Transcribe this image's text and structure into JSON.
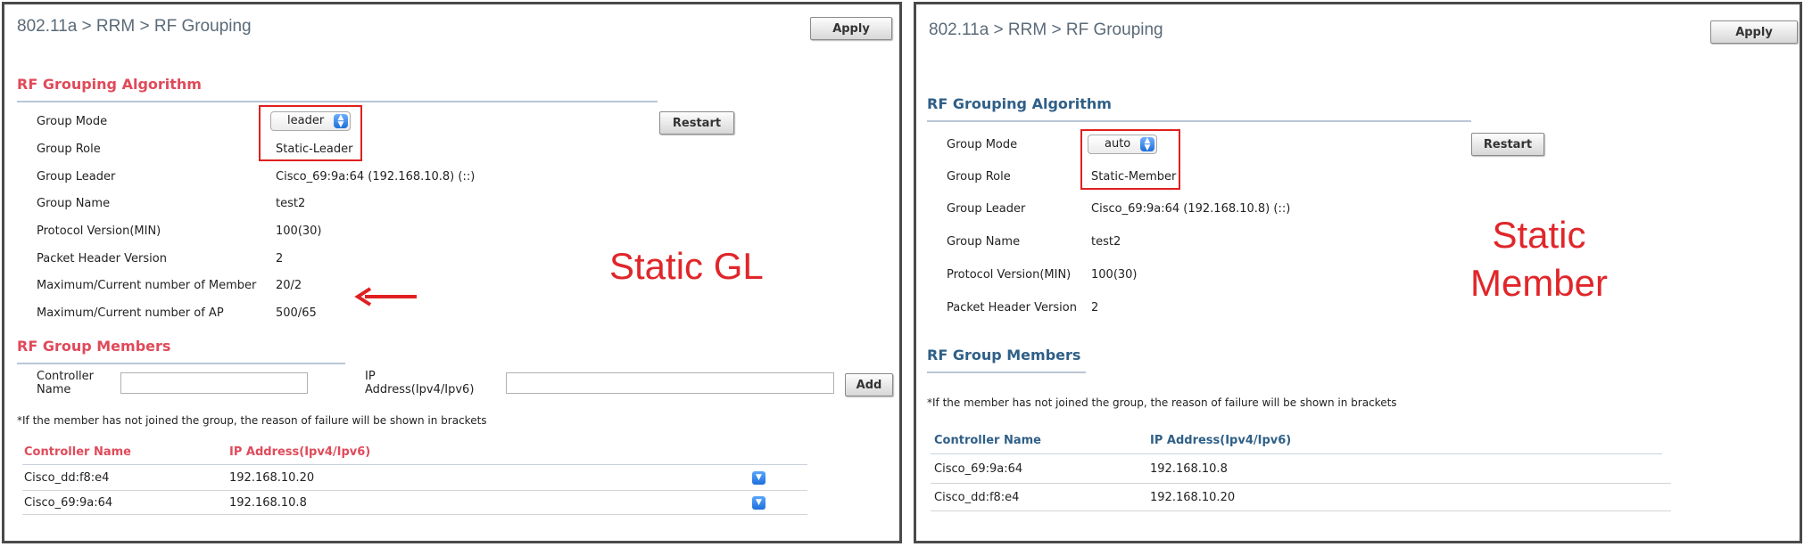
{
  "left": {
    "breadcrumb": "802.11a > RRM > RF Grouping",
    "apply": "Apply",
    "algo_title": "RF Grouping Algorithm",
    "restart": "Restart",
    "rows": [
      {
        "label": "Group Mode",
        "value": "leader"
      },
      {
        "label": "Group Role",
        "value": "Static-Leader"
      },
      {
        "label": "Group Leader",
        "value": "Cisco_69:9a:64 (192.168.10.8) (::)"
      },
      {
        "label": "Group Name",
        "value": "test2"
      },
      {
        "label": "Protocol Version(MIN)",
        "value": "100(30)"
      },
      {
        "label": "Packet Header Version",
        "value": "2"
      },
      {
        "label": "Maximum/Current number of Member",
        "value": "20/2"
      },
      {
        "label": "Maximum/Current number of AP",
        "value": "500/65"
      }
    ],
    "annotation": "Static GL",
    "members_title": "RF Group Members",
    "controller_name_label_1": "Controller",
    "controller_name_label_2": "Name",
    "ip_label_1": "IP",
    "ip_label_2": "Address(Ipv4/Ipv6)",
    "add": "Add",
    "note": "*If the member has not joined the group, the reason of failure will be shown in brackets",
    "col_controller": "Controller Name",
    "col_ip": "IP Address(Ipv4/Ipv6)",
    "members": [
      {
        "name": "Cisco_dd:f8:e4",
        "ip": "192.168.10.20"
      },
      {
        "name": "Cisco_69:9a:64",
        "ip": "192.168.10.8"
      }
    ]
  },
  "right": {
    "breadcrumb": "802.11a > RRM > RF Grouping",
    "apply": "Apply",
    "algo_title": "RF Grouping Algorithm",
    "restart": "Restart",
    "rows": [
      {
        "label": "Group Mode",
        "value": "auto"
      },
      {
        "label": "Group Role",
        "value": "Static-Member"
      },
      {
        "label": "Group Leader",
        "value": "Cisco_69:9a:64 (192.168.10.8) (::)"
      },
      {
        "label": "Group Name",
        "value": "test2"
      },
      {
        "label": "Protocol Version(MIN)",
        "value": "100(30)"
      },
      {
        "label": "Packet Header Version",
        "value": "2"
      }
    ],
    "annotation_1": "Static",
    "annotation_2": "Member",
    "members_title": "RF Group Members",
    "note": "*If the member has not joined the group, the reason of failure will be shown in brackets",
    "col_controller": "Controller Name",
    "col_ip": "IP Address(Ipv4/Ipv6)",
    "members": [
      {
        "name": "Cisco_69:9a:64",
        "ip": "192.168.10.8"
      },
      {
        "name": "Cisco_dd:f8:e4",
        "ip": "192.168.10.20"
      }
    ]
  },
  "colors": {
    "highlight": "#e02020",
    "accent_left": "#e04a5a",
    "accent_right": "#2f5f87"
  }
}
